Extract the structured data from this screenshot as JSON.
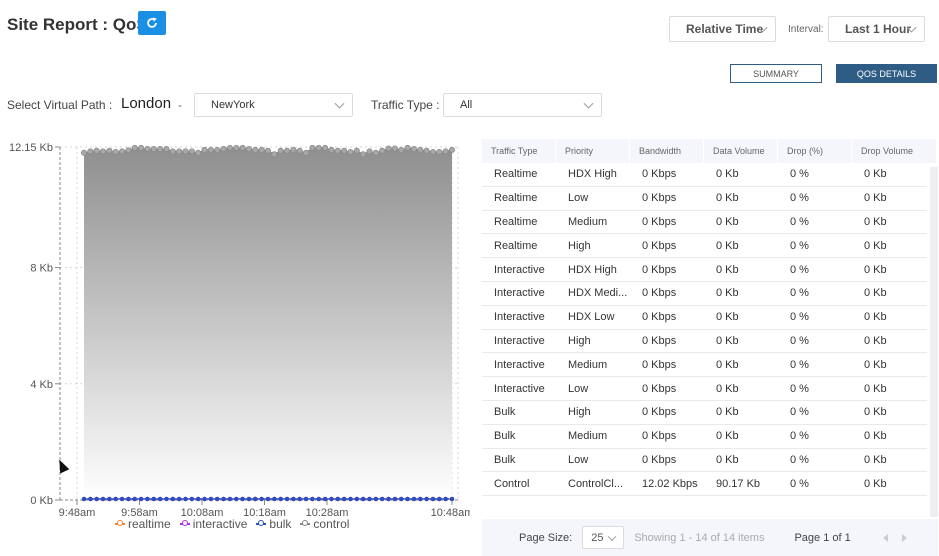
{
  "header": {
    "title": "Site Report : QoS",
    "time_mode": "Relative Time",
    "interval_label": "Interval:",
    "interval_value": "Last 1 Hour",
    "summary_label": "SUMMARY",
    "qos_details_label": "QOS DETAILS"
  },
  "filters": {
    "virtual_path_label": "Select Virtual Path :",
    "source_site": "London",
    "separator": "-",
    "destination_site": "NewYork",
    "traffic_type_label": "Traffic Type :",
    "traffic_type_value": "All"
  },
  "colors": {
    "accent": "#1a8fe3",
    "primary_button": "#2f5c85",
    "realtime": "#f5822a",
    "interactive": "#a733e8",
    "bulk": "#2b4fbf",
    "control": "#888888"
  },
  "chart_data": {
    "type": "area",
    "title": "",
    "xlabel": "",
    "ylabel": "",
    "y_ticks": [
      "0 Kb",
      "4 Kb",
      "8 Kb",
      "12.15 Kb"
    ],
    "y_tick_values": [
      0,
      4,
      8,
      12.15
    ],
    "ylim": [
      0,
      12.15
    ],
    "x_ticks": [
      "9:48am",
      "9:58am",
      "10:08am",
      "10:18am",
      "10:28am",
      "10:48am"
    ],
    "x_tick_minutes": [
      0,
      10,
      20,
      30,
      40,
      60
    ],
    "xlim_minutes": [
      0,
      60
    ],
    "grid": true,
    "legend_position": "bottom",
    "legend": [
      "realtime",
      "interactive",
      "bulk",
      "control"
    ],
    "series": [
      {
        "name": "realtime",
        "values": [
          0,
          0,
          0,
          0,
          0,
          0,
          0,
          0,
          0,
          0,
          0,
          0,
          0,
          0,
          0,
          0,
          0,
          0,
          0,
          0,
          0,
          0,
          0,
          0,
          0,
          0,
          0,
          0,
          0,
          0,
          0,
          0,
          0,
          0,
          0,
          0,
          0,
          0,
          0,
          0,
          0,
          0,
          0,
          0,
          0,
          0,
          0,
          0,
          0,
          0,
          0,
          0,
          0,
          0,
          0,
          0,
          0,
          0,
          0
        ]
      },
      {
        "name": "interactive",
        "values": [
          0,
          0,
          0,
          0,
          0,
          0,
          0,
          0,
          0,
          0,
          0,
          0,
          0,
          0,
          0,
          0,
          0,
          0,
          0,
          0,
          0,
          0,
          0,
          0,
          0,
          0,
          0,
          0,
          0,
          0,
          0,
          0,
          0,
          0,
          0,
          0,
          0,
          0,
          0,
          0,
          0,
          0,
          0,
          0,
          0,
          0,
          0,
          0,
          0,
          0,
          0,
          0,
          0,
          0,
          0,
          0,
          0,
          0,
          0
        ]
      },
      {
        "name": "bulk",
        "values": [
          0,
          0,
          0,
          0,
          0,
          0,
          0,
          0,
          0,
          0,
          0,
          0,
          0,
          0,
          0,
          0,
          0,
          0,
          0,
          0,
          0,
          0,
          0,
          0,
          0,
          0,
          0,
          0,
          0,
          0,
          0,
          0,
          0,
          0,
          0,
          0,
          0,
          0,
          0,
          0,
          0,
          0,
          0,
          0,
          0,
          0,
          0,
          0,
          0,
          0,
          0,
          0,
          0,
          0,
          0,
          0,
          0,
          0,
          0
        ]
      },
      {
        "name": "control",
        "values": [
          11.95,
          12.0,
          12.02,
          12.0,
          12.02,
          11.98,
          12.0,
          12.04,
          12.12,
          12.12,
          12.08,
          12.08,
          12.08,
          12.08,
          12.0,
          12.0,
          12.0,
          12.0,
          11.95,
          12.05,
          12.05,
          12.05,
          12.08,
          12.12,
          12.12,
          12.12,
          12.08,
          12.05,
          12.05,
          12.02,
          11.9,
          12.02,
          12.02,
          12.05,
          12.02,
          11.95,
          12.12,
          12.12,
          12.12,
          12.05,
          12.02,
          12.02,
          11.98,
          12.02,
          11.9,
          12.0,
          11.95,
          12.02,
          12.1,
          12.1,
          12.05,
          12.12,
          12.08,
          12.05,
          12.02,
          11.98,
          11.98,
          12.0,
          12.05
        ]
      }
    ]
  },
  "table": {
    "columns": [
      "Traffic Type",
      "Priority",
      "Bandwidth",
      "Data Volume",
      "Drop (%)",
      "Drop Volume"
    ],
    "rows": [
      [
        "Realtime",
        "HDX High",
        "0 Kbps",
        "0 Kb",
        "0 %",
        "0 Kb"
      ],
      [
        "Realtime",
        "Low",
        "0 Kbps",
        "0 Kb",
        "0 %",
        "0 Kb"
      ],
      [
        "Realtime",
        "Medium",
        "0 Kbps",
        "0 Kb",
        "0 %",
        "0 Kb"
      ],
      [
        "Realtime",
        "High",
        "0 Kbps",
        "0 Kb",
        "0 %",
        "0 Kb"
      ],
      [
        "Interactive",
        "HDX High",
        "0 Kbps",
        "0 Kb",
        "0 %",
        "0 Kb"
      ],
      [
        "Interactive",
        "HDX Medi...",
        "0 Kbps",
        "0 Kb",
        "0 %",
        "0 Kb"
      ],
      [
        "Interactive",
        "HDX Low",
        "0 Kbps",
        "0 Kb",
        "0 %",
        "0 Kb"
      ],
      [
        "Interactive",
        "High",
        "0 Kbps",
        "0 Kb",
        "0 %",
        "0 Kb"
      ],
      [
        "Interactive",
        "Medium",
        "0 Kbps",
        "0 Kb",
        "0 %",
        "0 Kb"
      ],
      [
        "Interactive",
        "Low",
        "0 Kbps",
        "0 Kb",
        "0 %",
        "0 Kb"
      ],
      [
        "Bulk",
        "High",
        "0 Kbps",
        "0 Kb",
        "0 %",
        "0 Kb"
      ],
      [
        "Bulk",
        "Medium",
        "0 Kbps",
        "0 Kb",
        "0 %",
        "0 Kb"
      ],
      [
        "Bulk",
        "Low",
        "0 Kbps",
        "0 Kb",
        "0 %",
        "0 Kb"
      ],
      [
        "Control",
        "ControlCl...",
        "12.02 Kbps",
        "90.17 Kb",
        "0 %",
        "0 Kb"
      ]
    ],
    "footer": {
      "page_size_label": "Page Size:",
      "page_size_value": "25",
      "showing": "Showing 1 - 14 of 14 items",
      "page_of": "Page 1 of 1"
    }
  }
}
